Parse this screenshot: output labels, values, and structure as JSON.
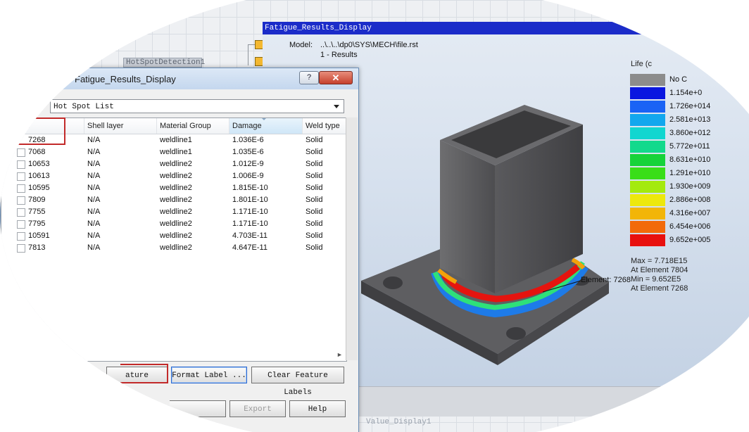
{
  "workflow": {
    "node_label": "HotSpotDetection1",
    "bottom_label": "Value_Display1"
  },
  "viewer": {
    "title": "Fatigue_Results_Display",
    "model_label": "Model:",
    "model_path": "..\\..\\..\\dp0\\SYS\\MECH\\file.rst",
    "results_line": "1 - Results",
    "legend_title": "Life (c",
    "legend": [
      {
        "label": "No C",
        "color": "#8c8c8c"
      },
      {
        "label": "1.154e+0",
        "color": "#0a16e0"
      },
      {
        "label": "1.726e+014",
        "color": "#1a63f5"
      },
      {
        "label": "2.581e+013",
        "color": "#12a7ee"
      },
      {
        "label": "3.860e+012",
        "color": "#11d6d0"
      },
      {
        "label": "5.772e+011",
        "color": "#12d98c"
      },
      {
        "label": "8.631e+010",
        "color": "#16d33a"
      },
      {
        "label": "1.291e+010",
        "color": "#39de18"
      },
      {
        "label": "1.930e+009",
        "color": "#a4ea0e"
      },
      {
        "label": "2.886e+008",
        "color": "#ede80c"
      },
      {
        "label": "4.316e+007",
        "color": "#f2b508"
      },
      {
        "label": "6.454e+006",
        "color": "#f26a0a"
      },
      {
        "label": "9.652e+005",
        "color": "#e8100e"
      }
    ],
    "max_line": "Max = 7.718E15",
    "max_element": "At Element 7804",
    "min_line": "Min = 9.652E5",
    "min_element": "At Element 7268",
    "element_label": "Element: 7268"
  },
  "dialog": {
    "title": "Fatigue_Results_Display",
    "help_glyph": "?",
    "close_glyph": "✕",
    "list_selector": "Hot Spot List",
    "columns": [
      "ent",
      "Shell layer",
      "Material Group",
      "Damage",
      "Weld type"
    ],
    "rows": [
      {
        "element": "7268",
        "shell": "N/A",
        "group": "weldline1",
        "damage": "1.036E-6",
        "weld": "Solid"
      },
      {
        "element": "7068",
        "shell": "N/A",
        "group": "weldline1",
        "damage": "1.035E-6",
        "weld": "Solid"
      },
      {
        "element": "10653",
        "shell": "N/A",
        "group": "weldline2",
        "damage": "1.012E-9",
        "weld": "Solid"
      },
      {
        "element": "10613",
        "shell": "N/A",
        "group": "weldline2",
        "damage": "1.006E-9",
        "weld": "Solid"
      },
      {
        "element": "10595",
        "shell": "N/A",
        "group": "weldline2",
        "damage": "1.815E-10",
        "weld": "Solid"
      },
      {
        "element": "7809",
        "shell": "N/A",
        "group": "weldline2",
        "damage": "1.801E-10",
        "weld": "Solid"
      },
      {
        "element": "7755",
        "shell": "N/A",
        "group": "weldline2",
        "damage": "1.171E-10",
        "weld": "Solid"
      },
      {
        "element": "7795",
        "shell": "N/A",
        "group": "weldline2",
        "damage": "1.171E-10",
        "weld": "Solid"
      },
      {
        "element": "10591",
        "shell": "N/A",
        "group": "weldline2",
        "damage": "4.703E-11",
        "weld": "Solid"
      },
      {
        "element": "7813",
        "shell": "N/A",
        "group": "weldline2",
        "damage": "4.647E-11",
        "weld": "Solid"
      }
    ],
    "btn_label_feature": "ature",
    "btn_format_label": "Format Label ...",
    "btn_clear_labels": "Clear Feature Labels",
    "btn_export": "Export",
    "btn_help": "Help"
  }
}
